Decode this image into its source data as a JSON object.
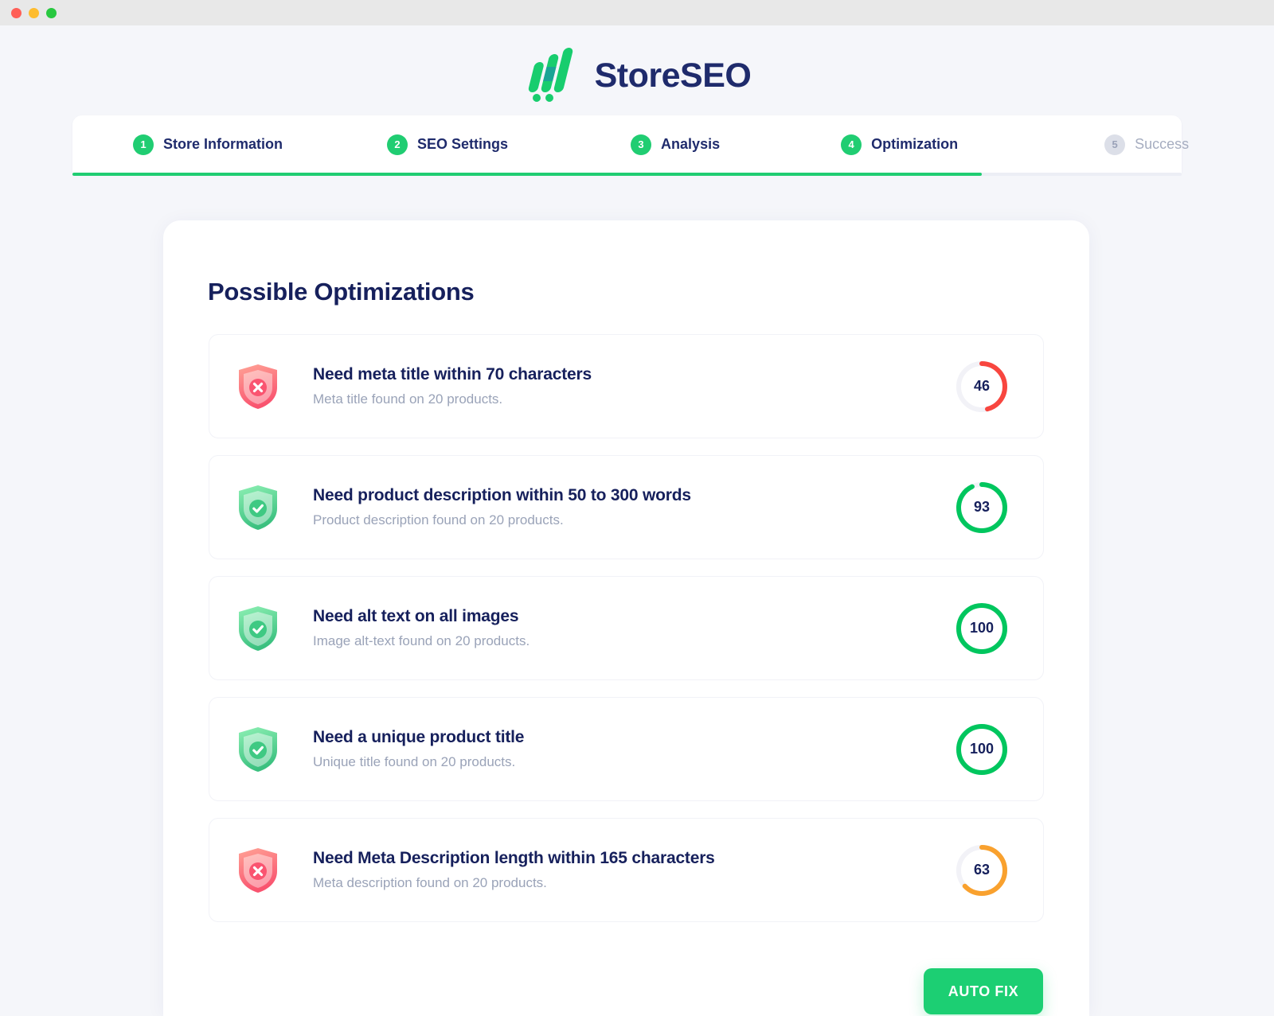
{
  "window": {
    "traffic_lights": [
      "close",
      "minimize",
      "zoom"
    ]
  },
  "brand": {
    "name": "StoreSEO",
    "logo_icon": "storeseo-logo-icon",
    "logo_color": "#1ccf73",
    "text_color": "#1f2b6c"
  },
  "stepper": {
    "steps": [
      {
        "number": "1",
        "label": "Store Information",
        "state": "complete"
      },
      {
        "number": "2",
        "label": "SEO Settings",
        "state": "complete"
      },
      {
        "number": "3",
        "label": "Analysis",
        "state": "complete"
      },
      {
        "number": "4",
        "label": "Optimization",
        "state": "current"
      },
      {
        "number": "5",
        "label": "Success",
        "state": "upcoming"
      }
    ],
    "progress_percent": 82,
    "active_color": "#20cd72",
    "inactive_color": "#dcdfe8"
  },
  "main": {
    "title": "Possible Optimizations",
    "rows": [
      {
        "icon": "shield-error-icon",
        "status": "error",
        "title": "Need meta title within 70 characters",
        "subtitle": "Meta title found on 20 products.",
        "score": "46",
        "score_value": 46,
        "ring_color": "#f8463f"
      },
      {
        "icon": "shield-check-icon",
        "status": "ok",
        "title": "Need product description within 50 to 300 words",
        "subtitle": "Product description found on 20 products.",
        "score": "93",
        "score_value": 93,
        "ring_color": "#00c65e"
      },
      {
        "icon": "shield-check-icon",
        "status": "ok",
        "title": "Need alt text on all images",
        "subtitle": "Image alt-text found on 20 products.",
        "score": "100",
        "score_value": 100,
        "ring_color": "#00c65e"
      },
      {
        "icon": "shield-check-icon",
        "status": "ok",
        "title": "Need a unique product title",
        "subtitle": "Unique title found on 20 products.",
        "score": "100",
        "score_value": 100,
        "ring_color": "#00c65e"
      },
      {
        "icon": "shield-error-icon",
        "status": "error",
        "title": "Need Meta Description length within 165 characters",
        "subtitle": "Meta description found on 20 products.",
        "score": "63",
        "score_value": 63,
        "ring_color": "#f9a12e"
      }
    ],
    "ring_track_color": "#f2f2f7"
  },
  "footer": {
    "autofix_label": "AUTO FIX",
    "autofix_color": "#1ccf73"
  }
}
